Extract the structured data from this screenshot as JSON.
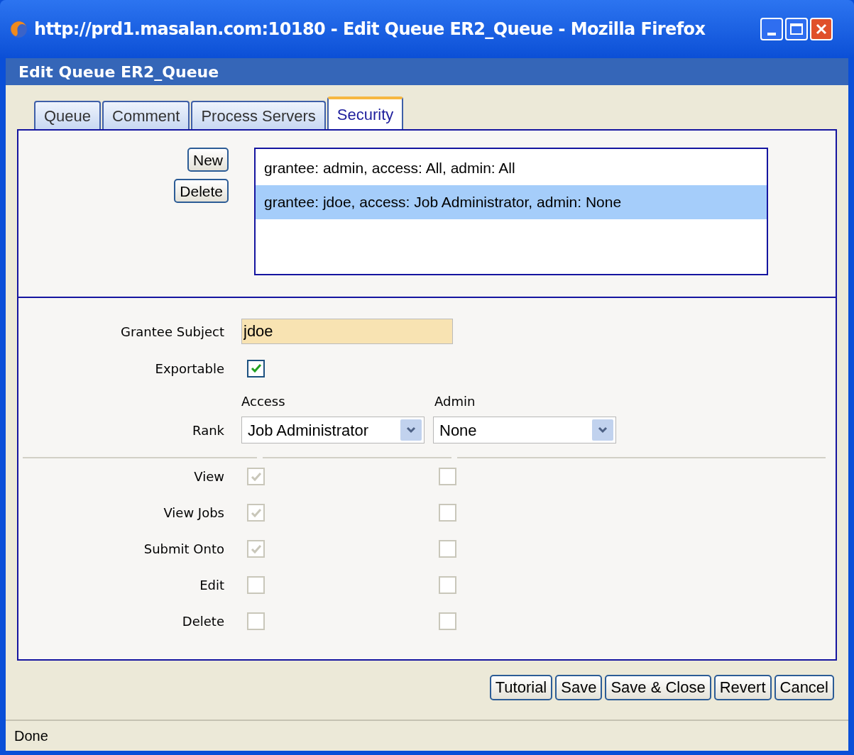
{
  "window": {
    "title": "http://prd1.masalan.com:10180 - Edit Queue ER2_Queue - Mozilla Firefox"
  },
  "header": {
    "title": "Edit Queue ER2_Queue"
  },
  "tabs": [
    {
      "label": "Queue",
      "selected": false
    },
    {
      "label": "Comment",
      "selected": false
    },
    {
      "label": "Process Servers",
      "selected": false
    },
    {
      "label": "Security",
      "selected": true
    }
  ],
  "list_buttons": [
    "New",
    "Delete"
  ],
  "grants": [
    {
      "text": "grantee: admin, access: All, admin: All",
      "selected": false
    },
    {
      "text": "grantee: jdoe, access: Job Administrator, admin: None",
      "selected": true
    }
  ],
  "form": {
    "grantee_subject": {
      "label": "Grantee Subject",
      "value": "jdoe"
    },
    "exportable": {
      "label": "Exportable",
      "checked": true
    },
    "column_headers": [
      "Access",
      "Admin"
    ],
    "rank": {
      "label": "Rank",
      "access_value": "Job Administrator",
      "admin_value": "None"
    },
    "permissions": [
      {
        "label": "View",
        "access": {
          "checked": true,
          "disabled": true
        },
        "admin": {
          "checked": false,
          "disabled": true
        }
      },
      {
        "label": "View Jobs",
        "access": {
          "checked": true,
          "disabled": true
        },
        "admin": {
          "checked": false,
          "disabled": true
        }
      },
      {
        "label": "Submit Onto",
        "access": {
          "checked": true,
          "disabled": true
        },
        "admin": {
          "checked": false,
          "disabled": true
        }
      },
      {
        "label": "Edit",
        "access": {
          "checked": false,
          "disabled": true
        },
        "admin": {
          "checked": false,
          "disabled": true
        }
      },
      {
        "label": "Delete",
        "access": {
          "checked": false,
          "disabled": true
        },
        "admin": {
          "checked": false,
          "disabled": true
        }
      }
    ]
  },
  "footer_buttons": [
    "Tutorial",
    "Save",
    "Save & Close",
    "Revert",
    "Cancel"
  ],
  "status_bar": {
    "text": "Done"
  }
}
